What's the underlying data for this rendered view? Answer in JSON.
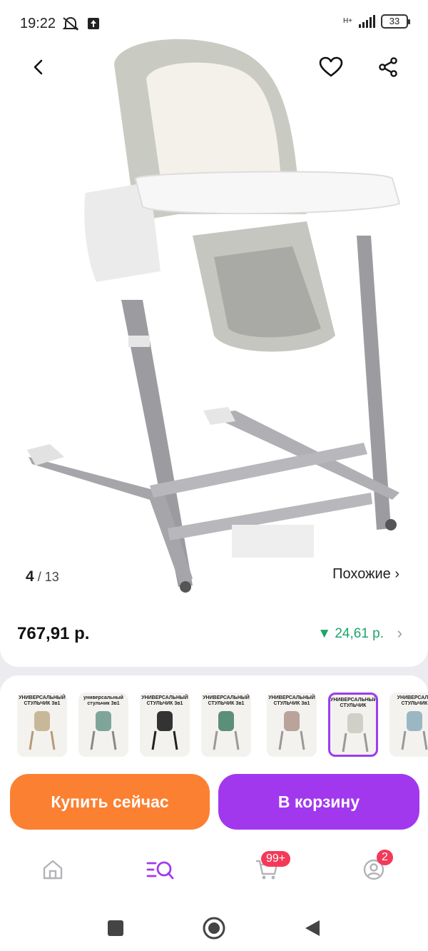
{
  "status_bar": {
    "time": "19:22",
    "network_label": "H+",
    "battery": "33"
  },
  "gallery": {
    "current": "4",
    "separator": " / ",
    "total": "13",
    "similar_label": "Похожие ›"
  },
  "price": {
    "value": "767,91 р.",
    "delta": "▼ 24,61 р.",
    "delta_color": "#1ea56a"
  },
  "thumbnails": [
    {
      "title": "УНИВЕРСАЛЬНЫЙ СТУЛЬЧИК 3в1",
      "selected": false
    },
    {
      "title": "универсальный стульчик 3в1",
      "selected": false
    },
    {
      "title": "УНИВЕРСАЛЬНЫЙ СТУЛЬЧИК 3в1",
      "selected": false
    },
    {
      "title": "УНИВЕРСАЛЬНЫЙ СТУЛЬЧИК 3в1",
      "selected": false
    },
    {
      "title": "УНИВЕРСАЛЬНЫЙ СТУЛЬЧИК 3в1",
      "selected": false
    },
    {
      "title": "УНИВЕРСАЛЬНЫЙ СТУЛЬЧИК",
      "selected": true
    },
    {
      "title": "УНИВЕРСАЛЬ СТУЛЬЧИК",
      "selected": false
    }
  ],
  "actions": {
    "buy_label": "Купить сейчас",
    "cart_label": "В корзину",
    "buy_color": "#fb8032",
    "cart_color": "#a238ee"
  },
  "bottom_nav": {
    "cart_badge": "99+",
    "profile_badge": "2",
    "accent": "#a238ee"
  }
}
